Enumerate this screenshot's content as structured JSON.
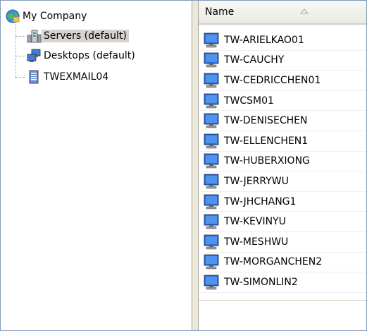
{
  "tree": {
    "root_label": "My Company",
    "items": [
      {
        "label": "Servers (default)",
        "icon": "server-group-icon",
        "selected": true
      },
      {
        "label": "Desktops (default)",
        "icon": "desktop-group-icon",
        "selected": false
      },
      {
        "label": "TWEXMAIL04",
        "icon": "server-icon",
        "selected": false
      }
    ]
  },
  "list": {
    "column_name": "Name",
    "sort": "ascending",
    "rows": [
      "TW-ARIELKAO01",
      "TW-CAUCHY",
      "TW-CEDRICCHEN01",
      "TWCSM01",
      "TW-DENISECHEN",
      "TW-ELLENCHEN1",
      "TW-HUBERXIONG",
      "TW-JERRYWU",
      "TW-JHCHANG1",
      "TW-KEVINYU",
      "TW-MESHWU",
      "TW-MORGANCHEN2",
      "TW-SIMONLIN2"
    ]
  },
  "colors": {
    "selection": "#d6d3ce",
    "splitter": "#ece9d8",
    "header": "#ebeae3"
  }
}
